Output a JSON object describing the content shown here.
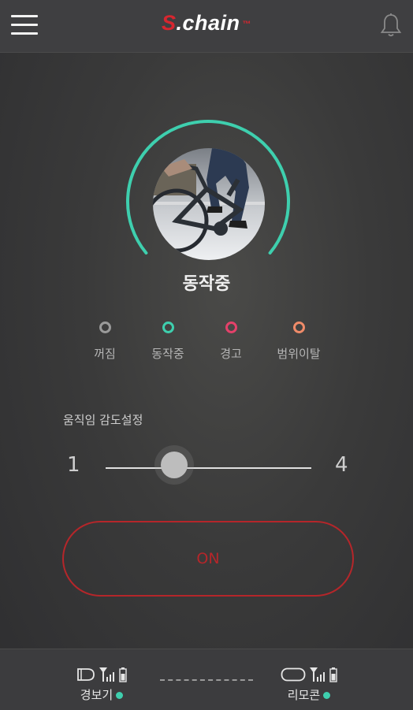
{
  "header": {
    "logo_s": "S",
    "logo_rest": ".chain",
    "logo_tm": "™"
  },
  "status": {
    "title": "동작중",
    "ring_color": "#3ecfae",
    "ring_progress": 0.72
  },
  "legend": [
    {
      "label": "꺼짐",
      "color": "#9a9a9a"
    },
    {
      "label": "동작중",
      "color": "#3ecfae"
    },
    {
      "label": "경고",
      "color": "#e4416a"
    },
    {
      "label": "범위이탈",
      "color": "#ef8b69"
    }
  ],
  "sensitivity": {
    "label": "움직임 감도설정",
    "min": "1",
    "max": "4",
    "value": 2
  },
  "power_button": {
    "label": "ON",
    "color": "#b5262a"
  },
  "bottom": {
    "alarm_label": "경보기",
    "remote_label": "리모콘",
    "status_color": "#3ecfae"
  },
  "icons": {
    "menu": "hamburger-menu-icon",
    "bell": "bell-icon",
    "alarm_device": "alarm-device-icon",
    "remote": "remote-device-icon",
    "signal": "signal-icon",
    "battery": "battery-icon"
  }
}
